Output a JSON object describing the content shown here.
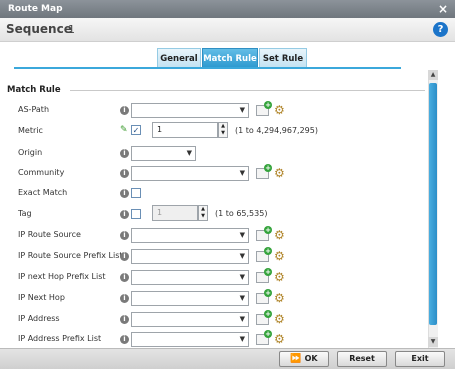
{
  "window": {
    "title": "Route Map",
    "close_glyph": "×"
  },
  "sequence": {
    "label": "Sequence",
    "value": "1"
  },
  "tabs": [
    {
      "label": "General"
    },
    {
      "label": "Match Rule"
    },
    {
      "label": "Set Rule"
    }
  ],
  "section": {
    "title": "Match Rule"
  },
  "fields": {
    "as_path": "AS-Path",
    "metric": "Metric",
    "metric_value": "1",
    "metric_range": "(1 to 4,294,967,295)",
    "origin": "Origin",
    "community": "Community",
    "exact_match": "Exact Match",
    "tag": "Tag",
    "tag_value": "1",
    "tag_range": "(1 to 65,535)",
    "ip_route_source": "IP Route Source",
    "ip_route_source_prefix_list": "IP Route Source Prefix List",
    "ip_next_hop_prefix_list": "IP next Hop Prefix List",
    "ip_next_hop": "IP Next Hop",
    "ip_address": "IP Address",
    "ip_address_prefix_list": "IP Address Prefix List"
  },
  "footer": {
    "ok": "OK",
    "reset": "Reset",
    "exit": "Exit"
  },
  "colors": {
    "accent": "#2f9ad0",
    "titlebar": "#7a8189"
  }
}
